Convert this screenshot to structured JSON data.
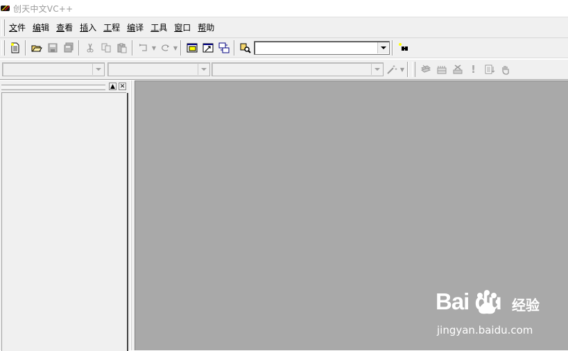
{
  "window": {
    "title": "创天中文VC++"
  },
  "menu": {
    "items": [
      {
        "label": "文件",
        "accel": "文"
      },
      {
        "label": "编辑",
        "accel": "编"
      },
      {
        "label": "查看",
        "accel": "查"
      },
      {
        "label": "插入",
        "accel": "插"
      },
      {
        "label": "工程",
        "accel": "工"
      },
      {
        "label": "编译",
        "accel": "编"
      },
      {
        "label": "工具",
        "accel": "工"
      },
      {
        "label": "窗口",
        "accel": "窗"
      },
      {
        "label": "帮助",
        "accel": "帮"
      }
    ]
  },
  "toolbar": {
    "find_combo_value": "",
    "buttons": [
      "new-file-icon",
      "open-folder-icon",
      "save-icon",
      "save-all-icon",
      "cut-icon",
      "copy-icon",
      "paste-icon",
      "undo-icon",
      "redo-icon",
      "workspace-icon",
      "output-icon",
      "window-list-icon",
      "find-in-files-icon",
      "find-icon"
    ]
  },
  "wizardbar": {
    "class_combo_value": "",
    "filter_combo_value": "",
    "members_combo_value": "",
    "buttons": [
      "wizard-action-icon",
      "compile-icon",
      "build-icon",
      "stop-build-icon",
      "execute-icon",
      "insert-breakpoint-icon",
      "go-icon"
    ]
  },
  "watermark": {
    "brand": "Bai du",
    "brand_cn": "经验",
    "url": "jingyan.baidu.com"
  },
  "colors": {
    "chrome": "#f0f0f0",
    "mdi_background": "#a9a9a9",
    "title_text": "#9a9a9a"
  }
}
